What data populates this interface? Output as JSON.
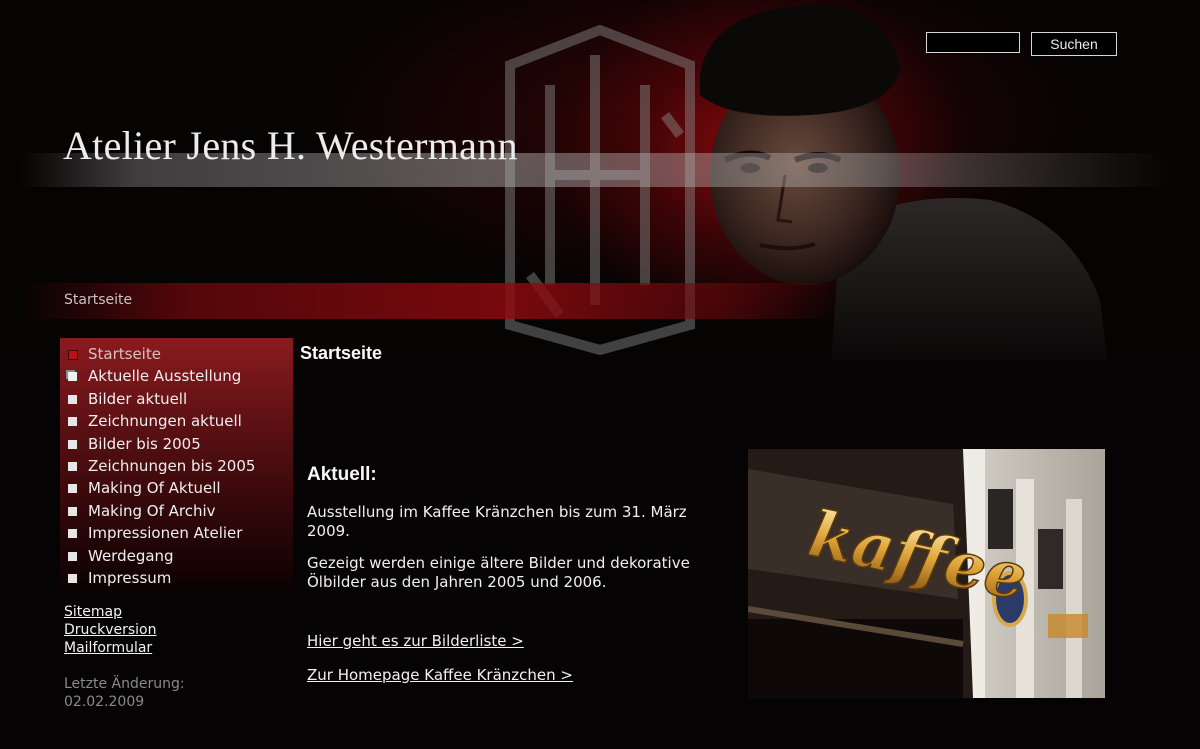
{
  "header": {
    "site_title": "Atelier Jens H. Westermann",
    "breadcrumb": "Startseite"
  },
  "search": {
    "value": "",
    "button_label": "Suchen"
  },
  "sidebar": {
    "items": [
      {
        "label": "Startseite",
        "state": "active"
      },
      {
        "label": "Aktuelle Ausstellung",
        "state": "current"
      },
      {
        "label": "Bilder aktuell",
        "state": "normal"
      },
      {
        "label": "Zeichnungen aktuell",
        "state": "normal"
      },
      {
        "label": "Bilder bis 2005",
        "state": "normal"
      },
      {
        "label": "Zeichnungen bis 2005",
        "state": "normal"
      },
      {
        "label": "Making Of Aktuell",
        "state": "normal"
      },
      {
        "label": "Making Of Archiv",
        "state": "normal"
      },
      {
        "label": "Impressionen Atelier",
        "state": "normal"
      },
      {
        "label": "Werdegang",
        "state": "normal"
      },
      {
        "label": "Impressum",
        "state": "normal"
      }
    ],
    "util_links": {
      "sitemap": "Sitemap",
      "print": "Druckversion",
      "mail": "Mailformular"
    },
    "last_change_label": "Letzte Änderung:",
    "last_change_date": "02.02.2009"
  },
  "main": {
    "page_title": "Startseite",
    "news_heading": "Aktuell:",
    "paragraph_1": "Ausstellung im Kaffee Kränzchen bis zum 31. März 2009.",
    "paragraph_2": "Gezeigt werden einige ältere Bilder und dekorative Ölbilder aus den Jahren 2005 und 2006.",
    "link_bilderliste": "Hier geht es zur Bilderliste >",
    "link_kaffee": "Zur Homepage Kaffee Kränzchen >",
    "photo_sign_text": "kaffee"
  },
  "colors": {
    "background": "#050303",
    "header_glow": "#960a0f",
    "nav_top": "#8a1b1f",
    "active_bullet": "#b4141a",
    "text": "#e8e8e8",
    "muted_text": "#8a8a8a"
  }
}
